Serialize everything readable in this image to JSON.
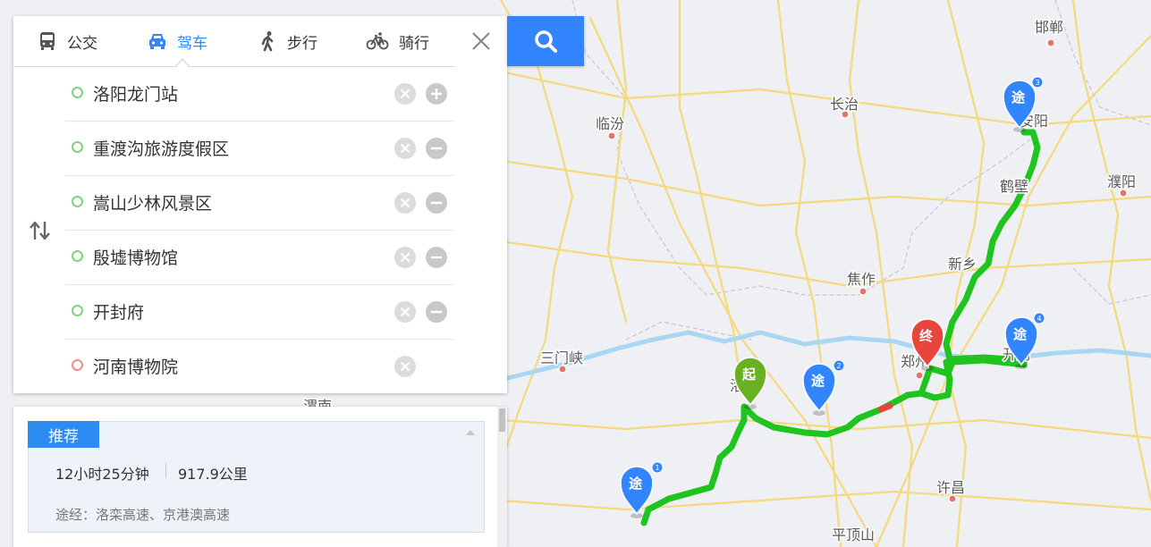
{
  "tabs": [
    {
      "label": "公交",
      "icon": "bus-icon"
    },
    {
      "label": "驾车",
      "icon": "car-icon"
    },
    {
      "label": "步行",
      "icon": "walk-icon"
    },
    {
      "label": "骑行",
      "icon": "bike-icon"
    }
  ],
  "active_tab": "驾车",
  "stops": [
    {
      "name": "洛阳龙门站",
      "action": "add"
    },
    {
      "name": "重渡沟旅游度假区",
      "action": "remove"
    },
    {
      "name": "嵩山少林风景区",
      "action": "remove"
    },
    {
      "name": "殷墟博物馆",
      "action": "remove"
    },
    {
      "name": "开封府",
      "action": "remove"
    },
    {
      "name": "河南博物院",
      "action": "none"
    }
  ],
  "result": {
    "badge": "推荐",
    "duration": "12小时25分钟",
    "distance": "917.9公里",
    "via": "途经：洛栾高速、京港澳高速"
  },
  "map": {
    "cities": [
      "邯郸",
      "长治",
      "临汾",
      "鹤壁",
      "濮阳",
      "新乡",
      "焦作",
      "三门峡",
      "洛阳",
      "郑州",
      "开封",
      "渭南",
      "许昌",
      "平顶山",
      "安阳"
    ],
    "markers": {
      "start": "起",
      "end": "终",
      "waypoint": "途",
      "waypoint_numbers": [
        "1",
        "2",
        "3",
        "4"
      ]
    },
    "colors": {
      "route": "#1fc41f",
      "start_pin": "#6ab023",
      "end_pin": "#e8453c",
      "waypoint_pin": "#3385ff",
      "accent": "#3385ff"
    }
  }
}
